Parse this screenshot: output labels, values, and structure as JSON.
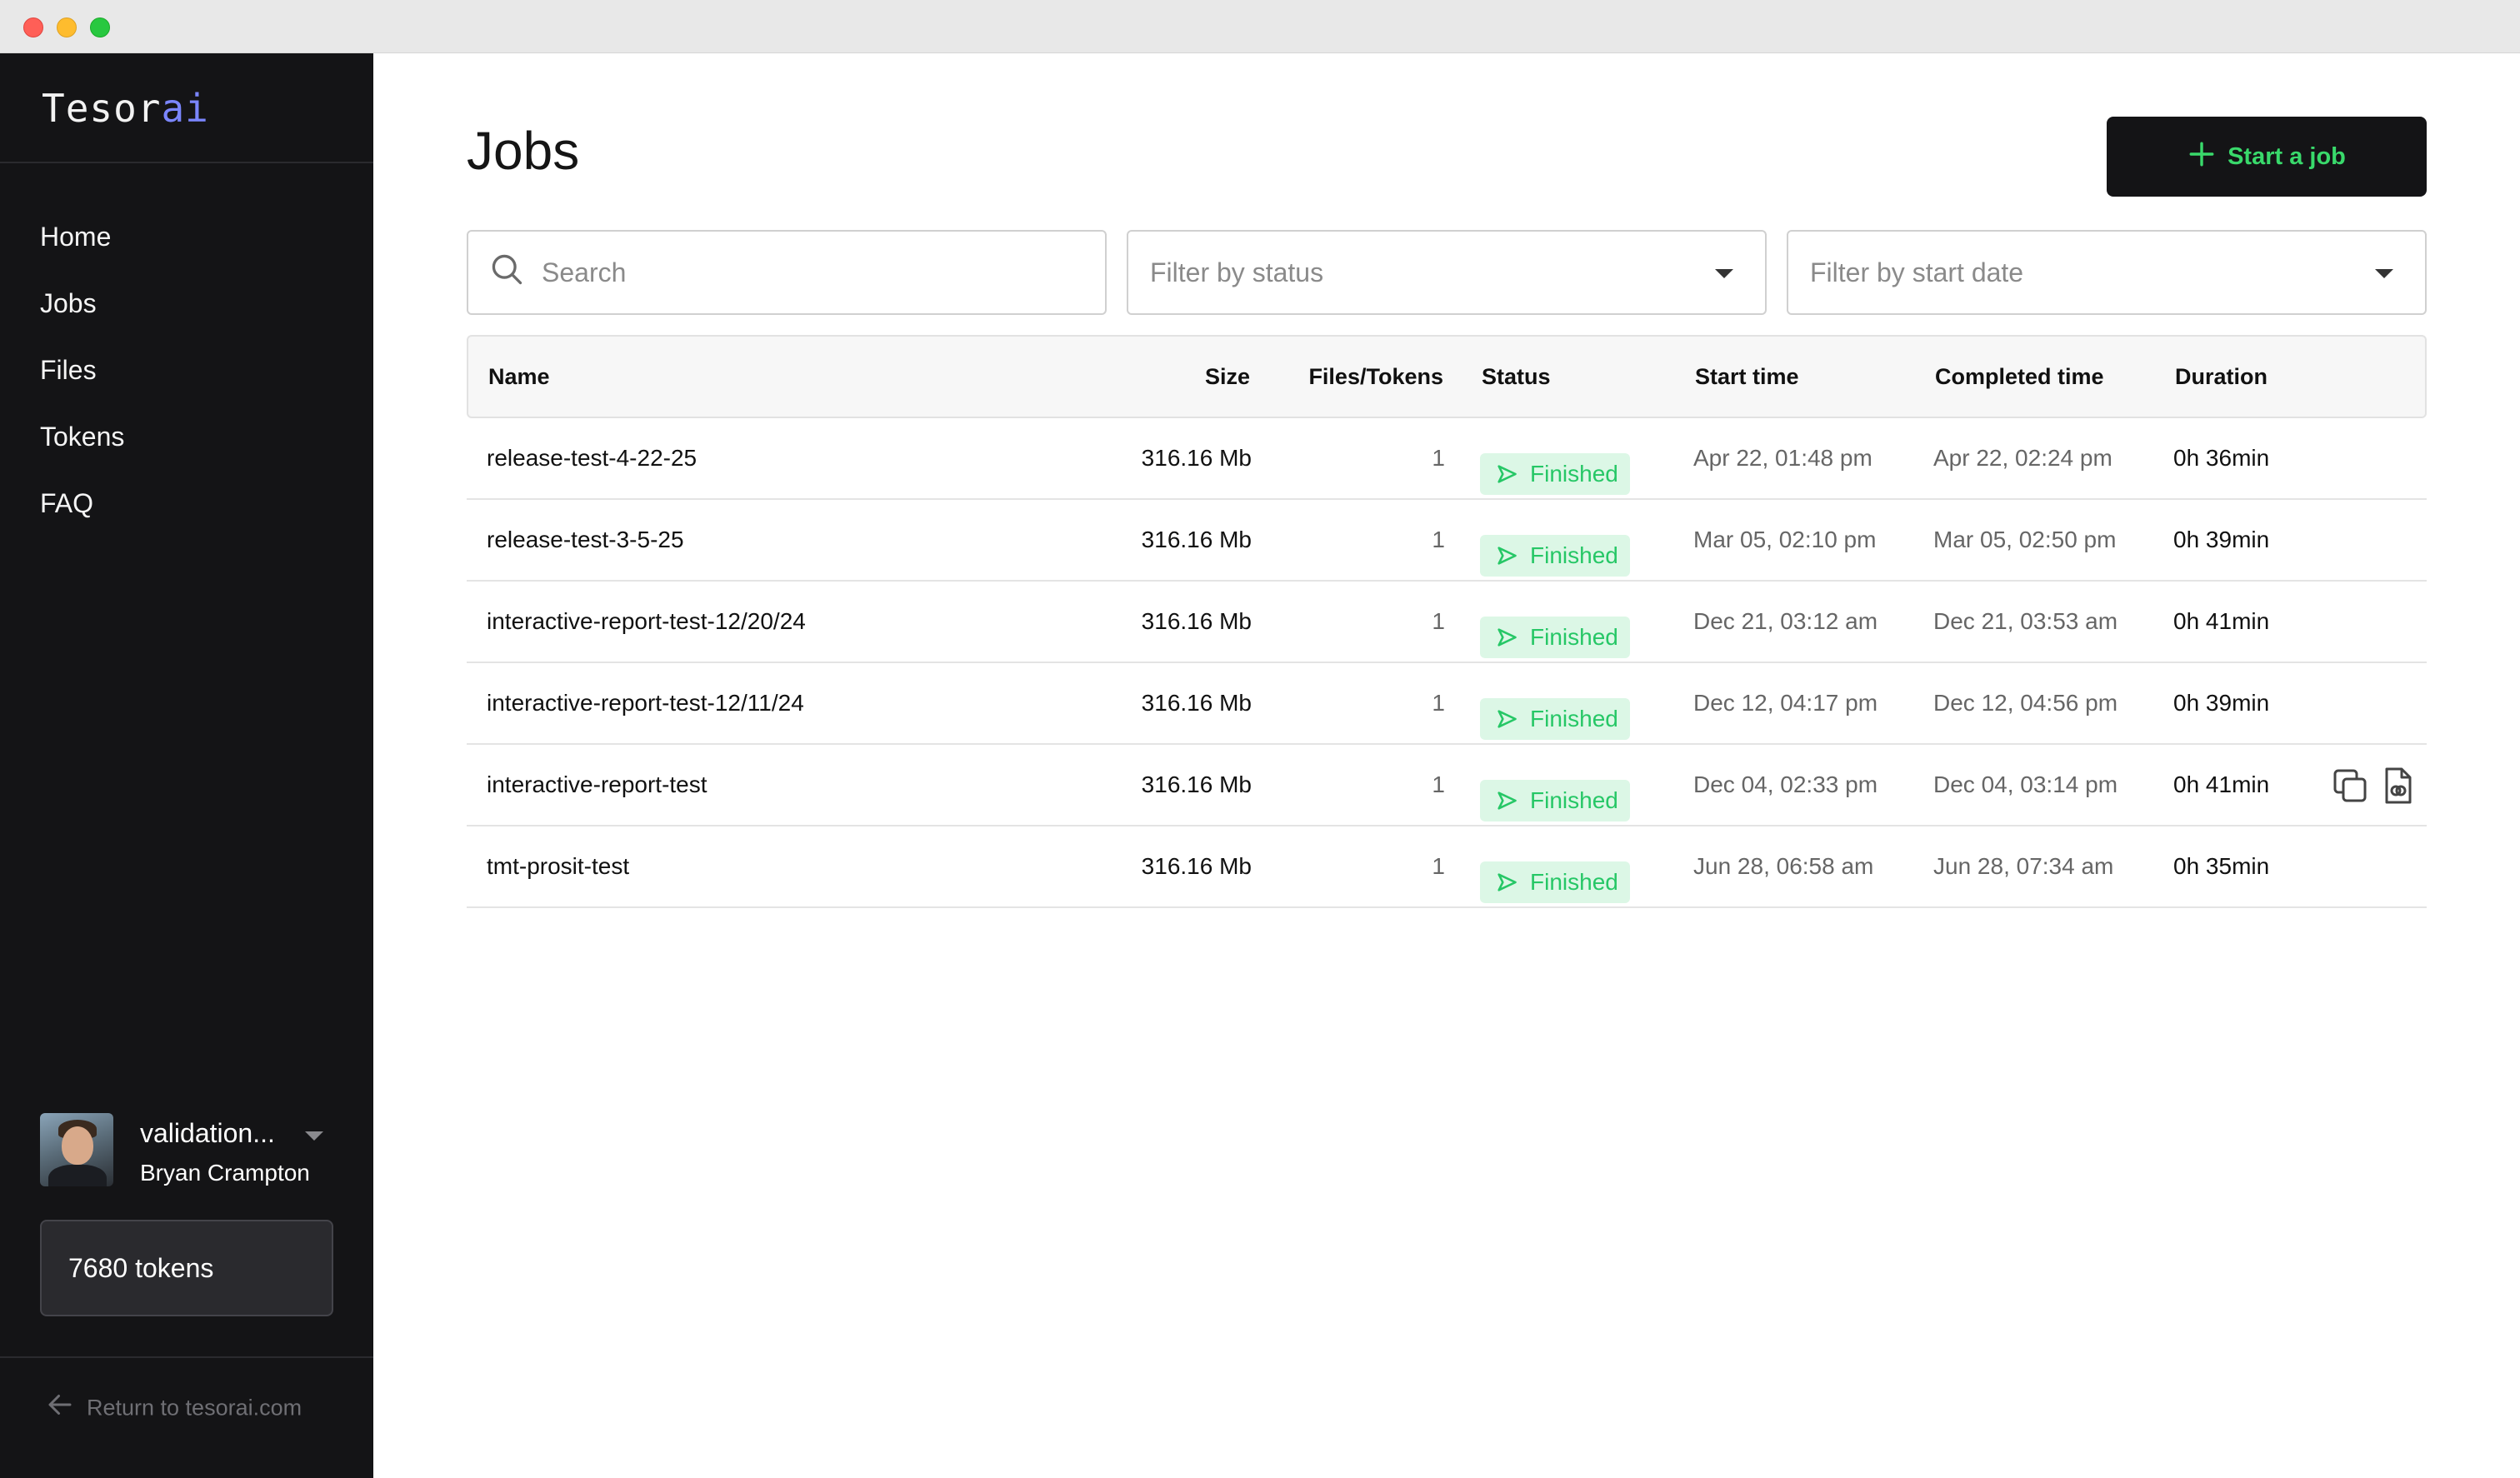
{
  "brand": {
    "name_prefix": "Tesor",
    "name_suffix": "ai"
  },
  "sidebar": {
    "items": [
      {
        "label": "Home"
      },
      {
        "label": "Jobs"
      },
      {
        "label": "Files"
      },
      {
        "label": "Tokens"
      },
      {
        "label": "FAQ"
      }
    ],
    "org_name": "validation...",
    "user_name": "Bryan Crampton",
    "tokens": "7680 tokens",
    "return_link": "Return to tesorai.com"
  },
  "page": {
    "title": "Jobs",
    "start_button": "Start a job"
  },
  "filters": {
    "search_placeholder": "Search",
    "status_placeholder": "Filter by status",
    "date_placeholder": "Filter by start date"
  },
  "table": {
    "headers": {
      "name": "Name",
      "size": "Size",
      "files": "Files/Tokens",
      "status": "Status",
      "start": "Start time",
      "completed": "Completed time",
      "duration": "Duration"
    },
    "rows": [
      {
        "name": "release-test-4-22-25",
        "size": "316.16 Mb",
        "files": "1",
        "status": "Finished",
        "start": "Apr 22, 01:48 pm",
        "completed": "Apr 22, 02:24 pm",
        "duration": "0h 36min"
      },
      {
        "name": "release-test-3-5-25",
        "size": "316.16 Mb",
        "files": "1",
        "status": "Finished",
        "start": "Mar 05, 02:10 pm",
        "completed": "Mar 05, 02:50 pm",
        "duration": "0h 39min"
      },
      {
        "name": "interactive-report-test-12/20/24",
        "size": "316.16 Mb",
        "files": "1",
        "status": "Finished",
        "start": "Dec 21, 03:12 am",
        "completed": "Dec 21, 03:53 am",
        "duration": "0h 41min"
      },
      {
        "name": "interactive-report-test-12/11/24",
        "size": "316.16 Mb",
        "files": "1",
        "status": "Finished",
        "start": "Dec 12, 04:17 pm",
        "completed": "Dec 12, 04:56 pm",
        "duration": "0h 39min"
      },
      {
        "name": "interactive-report-test",
        "size": "316.16 Mb",
        "files": "1",
        "status": "Finished",
        "start": "Dec 04, 02:33 pm",
        "completed": "Dec 04, 03:14 pm",
        "duration": "0h 41min"
      },
      {
        "name": "tmt-prosit-test",
        "size": "316.16 Mb",
        "files": "1",
        "status": "Finished",
        "start": "Jun 28, 06:58 am",
        "completed": "Jun 28, 07:34 am",
        "duration": "0h 35min"
      }
    ]
  },
  "colors": {
    "sidebar_bg": "#141416",
    "accent_green": "#39d96b",
    "badge_bg": "#dcf7e6",
    "brand_ai": "#7b86ff"
  },
  "icons": {
    "search": "search-icon",
    "plus": "plus-icon",
    "caret": "chevron-down-icon",
    "status": "play-outline-icon",
    "copy": "copy-icon",
    "report": "report-file-icon",
    "back": "arrow-left-icon"
  }
}
